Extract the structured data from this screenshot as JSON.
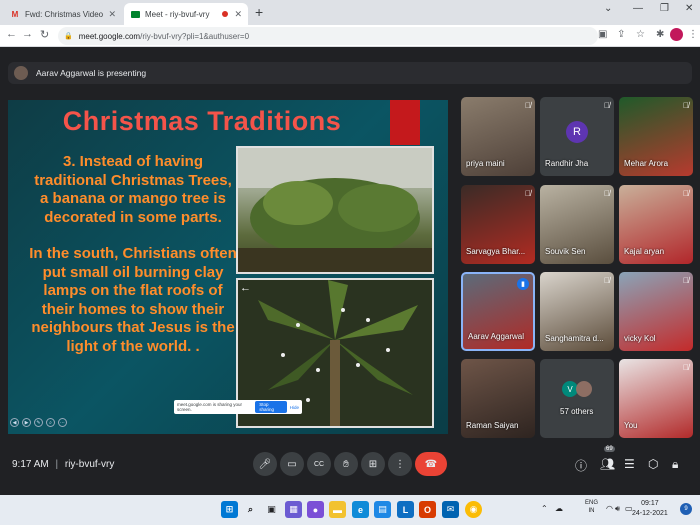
{
  "browser": {
    "tabs": [
      {
        "favicon": "M",
        "title": "Fwd: Christmas Video Group A a"
      },
      {
        "favicon": "",
        "title": "Meet - riy-bvuf-vry"
      }
    ],
    "url_host": "meet.google.com",
    "url_path": "/riy-bvuf-vry?pli=1&authuser=0"
  },
  "presenting": {
    "text": "Aarav Aggarwal is presenting"
  },
  "slide": {
    "title": "Christmas Traditions",
    "para1": "3. Instead of having traditional Christmas Trees, a banana or mango tree is decorated in some parts.",
    "para2": "In the south, Christians often put small oil burning clay lamps on the flat roofs of their homes to show their neighbours that Jesus is the light of the world. ."
  },
  "share_bar": {
    "text": "meet.google.com is sharing your screen.",
    "stop_label": "Stop sharing",
    "hide_label": "Hide"
  },
  "participants": [
    {
      "name": "priya maini"
    },
    {
      "name": "Randhir Jha",
      "initial": "R"
    },
    {
      "name": "Mehar Arora"
    },
    {
      "name": "Sarvagya Bhar..."
    },
    {
      "name": "Souvik Sen"
    },
    {
      "name": "Kajal aryan"
    },
    {
      "name": "Aarav Aggarwal"
    },
    {
      "name": "Sanghamitra d..."
    },
    {
      "name": "vicky Kol"
    },
    {
      "name": "Raman Saiyan"
    },
    {
      "name": "57 others",
      "initial": "V"
    },
    {
      "name": "You"
    }
  ],
  "meeting": {
    "time": "9:17 AM",
    "separator": "|",
    "code": "riy-bvuf-vry",
    "people_count": "69"
  },
  "taskbar": {
    "lang1": "ENG",
    "lang2": "IN",
    "time": "09:17",
    "date": "24-12-2021",
    "notifications": "9"
  },
  "colors": {
    "title": "#f4544a",
    "body_text": "#ff8d2b",
    "end_call": "#ea4335",
    "accent": "#1a73e8"
  }
}
